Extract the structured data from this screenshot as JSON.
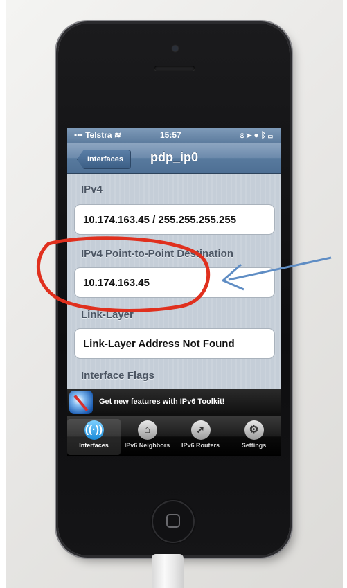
{
  "status_bar": {
    "carrier": "Telstra",
    "time": "15:57"
  },
  "nav": {
    "back_label": "Interfaces",
    "title": "pdp_ip0"
  },
  "sections": [
    {
      "header": "IPv4",
      "value": "10.174.163.45 / 255.255.255.255"
    },
    {
      "header": "IPv4 Point-to-Point Destination",
      "value": "10.174.163.45"
    },
    {
      "header": "Link-Layer",
      "value": "Link-Layer Address Not Found"
    },
    {
      "header": "Interface Flags"
    }
  ],
  "ad": {
    "text": "Get new features with IPv6 Toolkit!"
  },
  "tabs": [
    {
      "label": "Interfaces",
      "icon": "antenna-icon",
      "active": true
    },
    {
      "label": "IPv6 Neighbors",
      "icon": "home-icon",
      "active": false
    },
    {
      "label": "IPv6 Routers",
      "icon": "arrow-icon",
      "active": false
    },
    {
      "label": "Settings",
      "icon": "gear-icon",
      "active": false
    }
  ],
  "colors": {
    "annotation_circle": "#e0301e",
    "annotation_arrow": "#5f8dc4"
  }
}
